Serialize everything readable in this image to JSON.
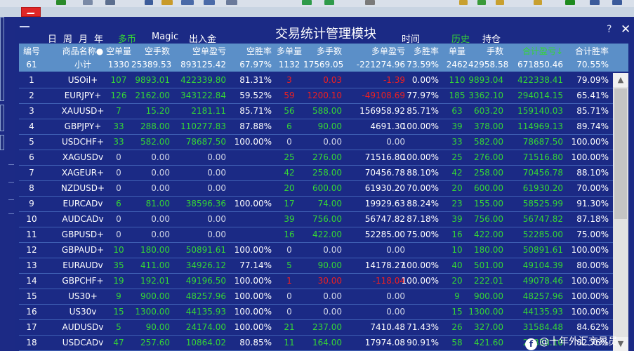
{
  "app": {
    "title": "交易统计管理模块",
    "help": "?",
    "close": "✕",
    "minimize": "—"
  },
  "nav": {
    "day": "日",
    "week": "周",
    "month": "月",
    "year": "年",
    "currency": "多币",
    "magic": "Magic",
    "deposit": "出入金",
    "time": "时间",
    "history": "历史",
    "positions": "持仓"
  },
  "columns": [
    "编号",
    "商品名称●",
    "空单量",
    "空手数",
    "空单盈亏",
    "空胜率",
    "多单量",
    "多手数",
    "多单盈亏",
    "多胜率",
    "单量",
    "手数",
    "合计盈亏↓",
    "合计胜率"
  ],
  "summary": [
    "61",
    "小计",
    "1330",
    "25389.53",
    "893125.42",
    "67.97%",
    "1132",
    "17569.05",
    "-221274.96",
    "73.59%",
    "2462",
    "42958.58",
    "671850.46",
    "70.55%"
  ],
  "rows": [
    [
      "1",
      "USOil+",
      "107",
      "9893.01",
      "422339.80",
      "81.31%",
      "3",
      "0.03",
      "-1.39",
      "0.00%",
      "110",
      "9893.04",
      "422338.41",
      "79.09%"
    ],
    [
      "2",
      "EURJPY+",
      "126",
      "2162.00",
      "343122.84",
      "59.52%",
      "59",
      "1200.10",
      "-49108.69",
      "77.97%",
      "185",
      "3362.10",
      "294014.15",
      "65.41%"
    ],
    [
      "3",
      "XAUUSD+",
      "7",
      "15.20",
      "2181.11",
      "85.71%",
      "56",
      "588.00",
      "156958.92",
      "85.71%",
      "63",
      "603.20",
      "159140.03",
      "85.71%"
    ],
    [
      "4",
      "GBPJPY+",
      "33",
      "288.00",
      "110277.83",
      "87.88%",
      "6",
      "90.00",
      "4691.30",
      "100.00%",
      "39",
      "378.00",
      "114969.13",
      "89.74%"
    ],
    [
      "5",
      "USDCHF+",
      "33",
      "582.00",
      "78687.50",
      "100.00%",
      "0",
      "0.00",
      "0.00",
      "",
      "33",
      "582.00",
      "78687.50",
      "100.00%"
    ],
    [
      "6",
      "XAGUSDv",
      "0",
      "0.00",
      "0.00",
      "",
      "25",
      "276.00",
      "71516.80",
      "100.00%",
      "25",
      "276.00",
      "71516.80",
      "100.00%"
    ],
    [
      "7",
      "XAGEUR+",
      "0",
      "0.00",
      "0.00",
      "",
      "42",
      "258.00",
      "70456.78",
      "88.10%",
      "42",
      "258.00",
      "70456.78",
      "88.10%"
    ],
    [
      "8",
      "NZDUSD+",
      "0",
      "0.00",
      "0.00",
      "",
      "20",
      "600.00",
      "61930.20",
      "70.00%",
      "20",
      "600.00",
      "61930.20",
      "70.00%"
    ],
    [
      "9",
      "EURCADv",
      "6",
      "81.00",
      "38596.36",
      "100.00%",
      "17",
      "74.00",
      "19929.63",
      "88.24%",
      "23",
      "155.00",
      "58525.99",
      "91.30%"
    ],
    [
      "10",
      "AUDCADv",
      "0",
      "0.00",
      "0.00",
      "",
      "39",
      "756.00",
      "56747.82",
      "87.18%",
      "39",
      "756.00",
      "56747.82",
      "87.18%"
    ],
    [
      "11",
      "GBPUSD+",
      "0",
      "0.00",
      "0.00",
      "",
      "16",
      "422.00",
      "52285.00",
      "75.00%",
      "16",
      "422.00",
      "52285.00",
      "75.00%"
    ],
    [
      "12",
      "GBPAUD+",
      "10",
      "180.00",
      "50891.61",
      "100.00%",
      "0",
      "0.00",
      "0.00",
      "",
      "10",
      "180.00",
      "50891.61",
      "100.00%"
    ],
    [
      "13",
      "EURAUDv",
      "35",
      "411.00",
      "34926.12",
      "77.14%",
      "5",
      "90.00",
      "14178.27",
      "100.00%",
      "40",
      "501.00",
      "49104.39",
      "80.00%"
    ],
    [
      "14",
      "GBPCHF+",
      "19",
      "192.01",
      "49196.50",
      "100.00%",
      "1",
      "30.00",
      "-118.04",
      "100.00%",
      "20",
      "222.01",
      "49078.46",
      "100.00%"
    ],
    [
      "15",
      "US30+",
      "9",
      "900.00",
      "48257.96",
      "100.00%",
      "0",
      "0.00",
      "0.00",
      "",
      "9",
      "900.00",
      "48257.96",
      "100.00%"
    ],
    [
      "16",
      "US30v",
      "15",
      "1300.00",
      "44135.93",
      "100.00%",
      "0",
      "0.00",
      "0.00",
      "",
      "15",
      "1300.00",
      "44135.93",
      "100.00%"
    ],
    [
      "17",
      "AUDUSDv",
      "5",
      "90.00",
      "24174.00",
      "100.00%",
      "21",
      "237.00",
      "7410.48",
      "71.43%",
      "26",
      "327.00",
      "31584.48",
      "84.62%"
    ],
    [
      "18",
      "USDCADv",
      "47",
      "257.60",
      "10864.02",
      "80.85%",
      "11",
      "164.00",
      "17974.08",
      "90.91%",
      "58",
      "421.60",
      "28838.10",
      "82.76%"
    ]
  ],
  "watermark": "@十年外汇交易员",
  "watermark_logo": "f",
  "colors": {
    "background": "#1b2a85",
    "header": "#5b8fc8",
    "positive": "#35d635",
    "negative": "#ee2020",
    "text": "#ffffff"
  }
}
